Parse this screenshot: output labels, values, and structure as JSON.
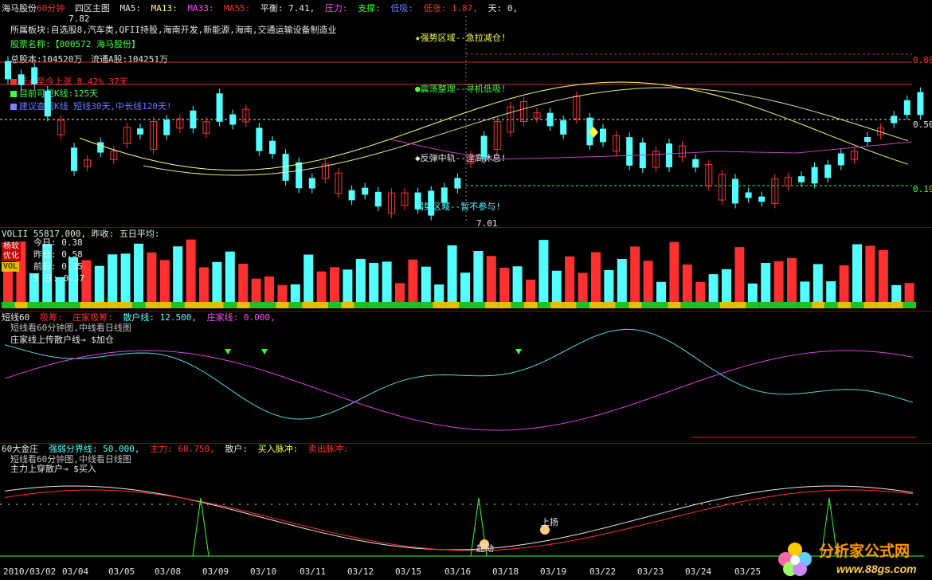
{
  "main_header": {
    "stock": "海马股份",
    "period": "60分钟",
    "chart_name": "四区主图",
    "ma5": "MA5:",
    "ma13": "MA13:",
    "ma33": "MA33:",
    "ma55": "MA55:",
    "balance": "平衡: 7.41,",
    "pressure": "压力:",
    "support": "支撑:",
    "low_buy": "低吸:",
    "drop": "低涨: 1.87,",
    "day": "天: 0,"
  },
  "info": {
    "sectors": "所属板块:自选股8,汽车类,QFII持股,海南开发,新能源,海南,交通运输设备制造业",
    "stock_name": "股票名称:【000572 海马股份】",
    "total_share": "总股本:104520万",
    "float_share": "流通A股:104251万",
    "low_point": "低点至今上涨 8.42%  37天",
    "visible_k": "目前可见K线:125天",
    "advice": "建议查阅K线 短线30天,中长线120天!"
  },
  "zones": {
    "strong": "★强势区域--急拉减仓!",
    "shock": "●震荡整理--寻机低吸!",
    "rebound": "◆反弹中轨--逢高休息!",
    "weak": "弱势区域--暂不参与!"
  },
  "price_marks": {
    "high": "7.82",
    "low": "7.01",
    "right_top": "0.80",
    "right_mid": "0.50",
    "right_low": "0.19"
  },
  "vol_panel": {
    "header": "VOLII  55817.000, 昨收: 五日平均:",
    "badge1": "杨软",
    "badge2": "优化",
    "badge3": "VOL",
    "today": "今日: 0.38",
    "yesterday": "昨日: 0.58",
    "prev": "前日: 0.35",
    "five": "5 日: 0.37"
  },
  "short_panel": {
    "title": "短线60",
    "absorb": "吸筹:",
    "banker": "庄家吸筹:",
    "retail": "散户线: 12.500,",
    "banker_line": "庄家线: 0.000,",
    "note1": "短线看60分钟图,中线看日线图",
    "note2": "庄家线上传散户线→ $加仓"
  },
  "gold_panel": {
    "title": "60大金庄",
    "strong_weak": "强弱分界线: 50.000,",
    "main_force": "主力: 68.750,",
    "retail": "散户:",
    "buy_pulse": "买入脉冲:",
    "sell_pulse": "卖出脉冲:",
    "note1": "短线看60分钟图,中线看日线图",
    "note2": "主力上穿散户→ $买入",
    "tag_up": "上扬",
    "tag_start": "起动"
  },
  "dates": [
    "2010/03/02",
    "03/04",
    "03/05",
    "03/08",
    "03/09",
    "03/10",
    "03/11",
    "03/12",
    "03/15",
    "03/16",
    "03/18",
    "03/19",
    "03/22",
    "03/23",
    "03/24",
    "03/25"
  ],
  "logo": {
    "name": "分析家公式网",
    "url": "www.88gs.com"
  },
  "colors": {
    "up": "#ff3030",
    "down": "#54ffff",
    "ma_yellow": "#ffff80",
    "ma_magenta": "#c040c0",
    "panel_border": "#8b0000"
  }
}
